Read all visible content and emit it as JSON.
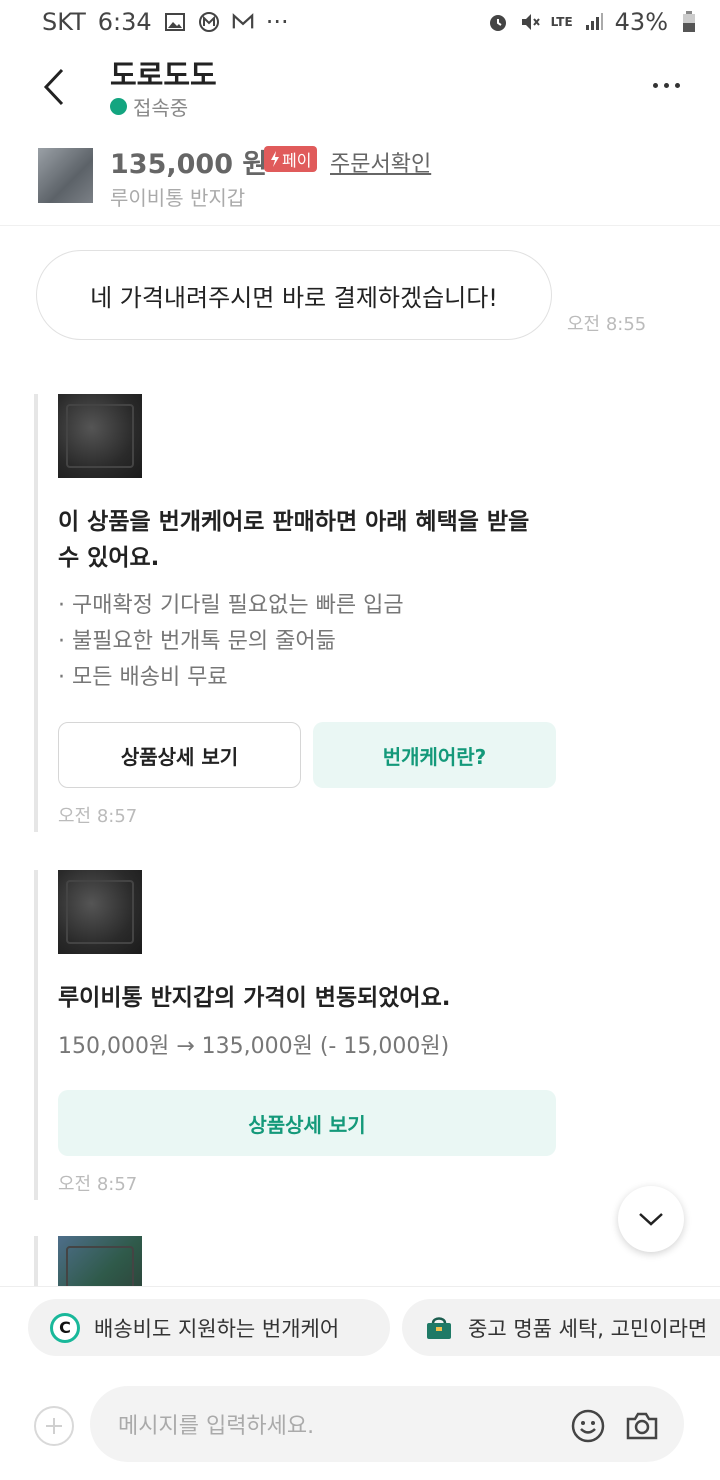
{
  "status_bar": {
    "carrier": "SKT",
    "time": "6:34",
    "network": "LTE",
    "battery": "43%"
  },
  "header": {
    "title": "도로도도",
    "presence": "접속중"
  },
  "product": {
    "price": "135,000 원",
    "pay_badge": "페이",
    "order_link": "주문서확인",
    "name": "루이비통 반지갑"
  },
  "messages": {
    "bubble_text": "네 가격내려주시면 바로 결제하겠습니다!",
    "bubble_time": "오전 8:55"
  },
  "card1": {
    "title": "이 상품을 번개케어로 판매하면 아래 혜택을 받을 수 있어요.",
    "bullets": [
      "· 구매확정 기다릴 필요없는 빠른 입금",
      "· 불필요한 번개톡 문의 줄어듦",
      "· 모든 배송비 무료"
    ],
    "btn_detail": "상품상세 보기",
    "btn_care": "번개케어란?",
    "time": "오전 8:57"
  },
  "card2": {
    "title": "루이비통 반지갑의 가격이 변동되었어요.",
    "price_change": "150,000원 → 135,000원 (- 15,000원)",
    "btn_detail": "상품상세 보기",
    "time": "오전 8:57"
  },
  "chips": {
    "chip1": "배송비도 지원하는 번개케어",
    "chip2": "중고 명품 세탁, 고민이라면"
  },
  "input": {
    "placeholder": "메시지를 입력하세요."
  },
  "colors": {
    "accent": "#14997a",
    "presence": "#13a580",
    "pay": "#e05b5b"
  }
}
